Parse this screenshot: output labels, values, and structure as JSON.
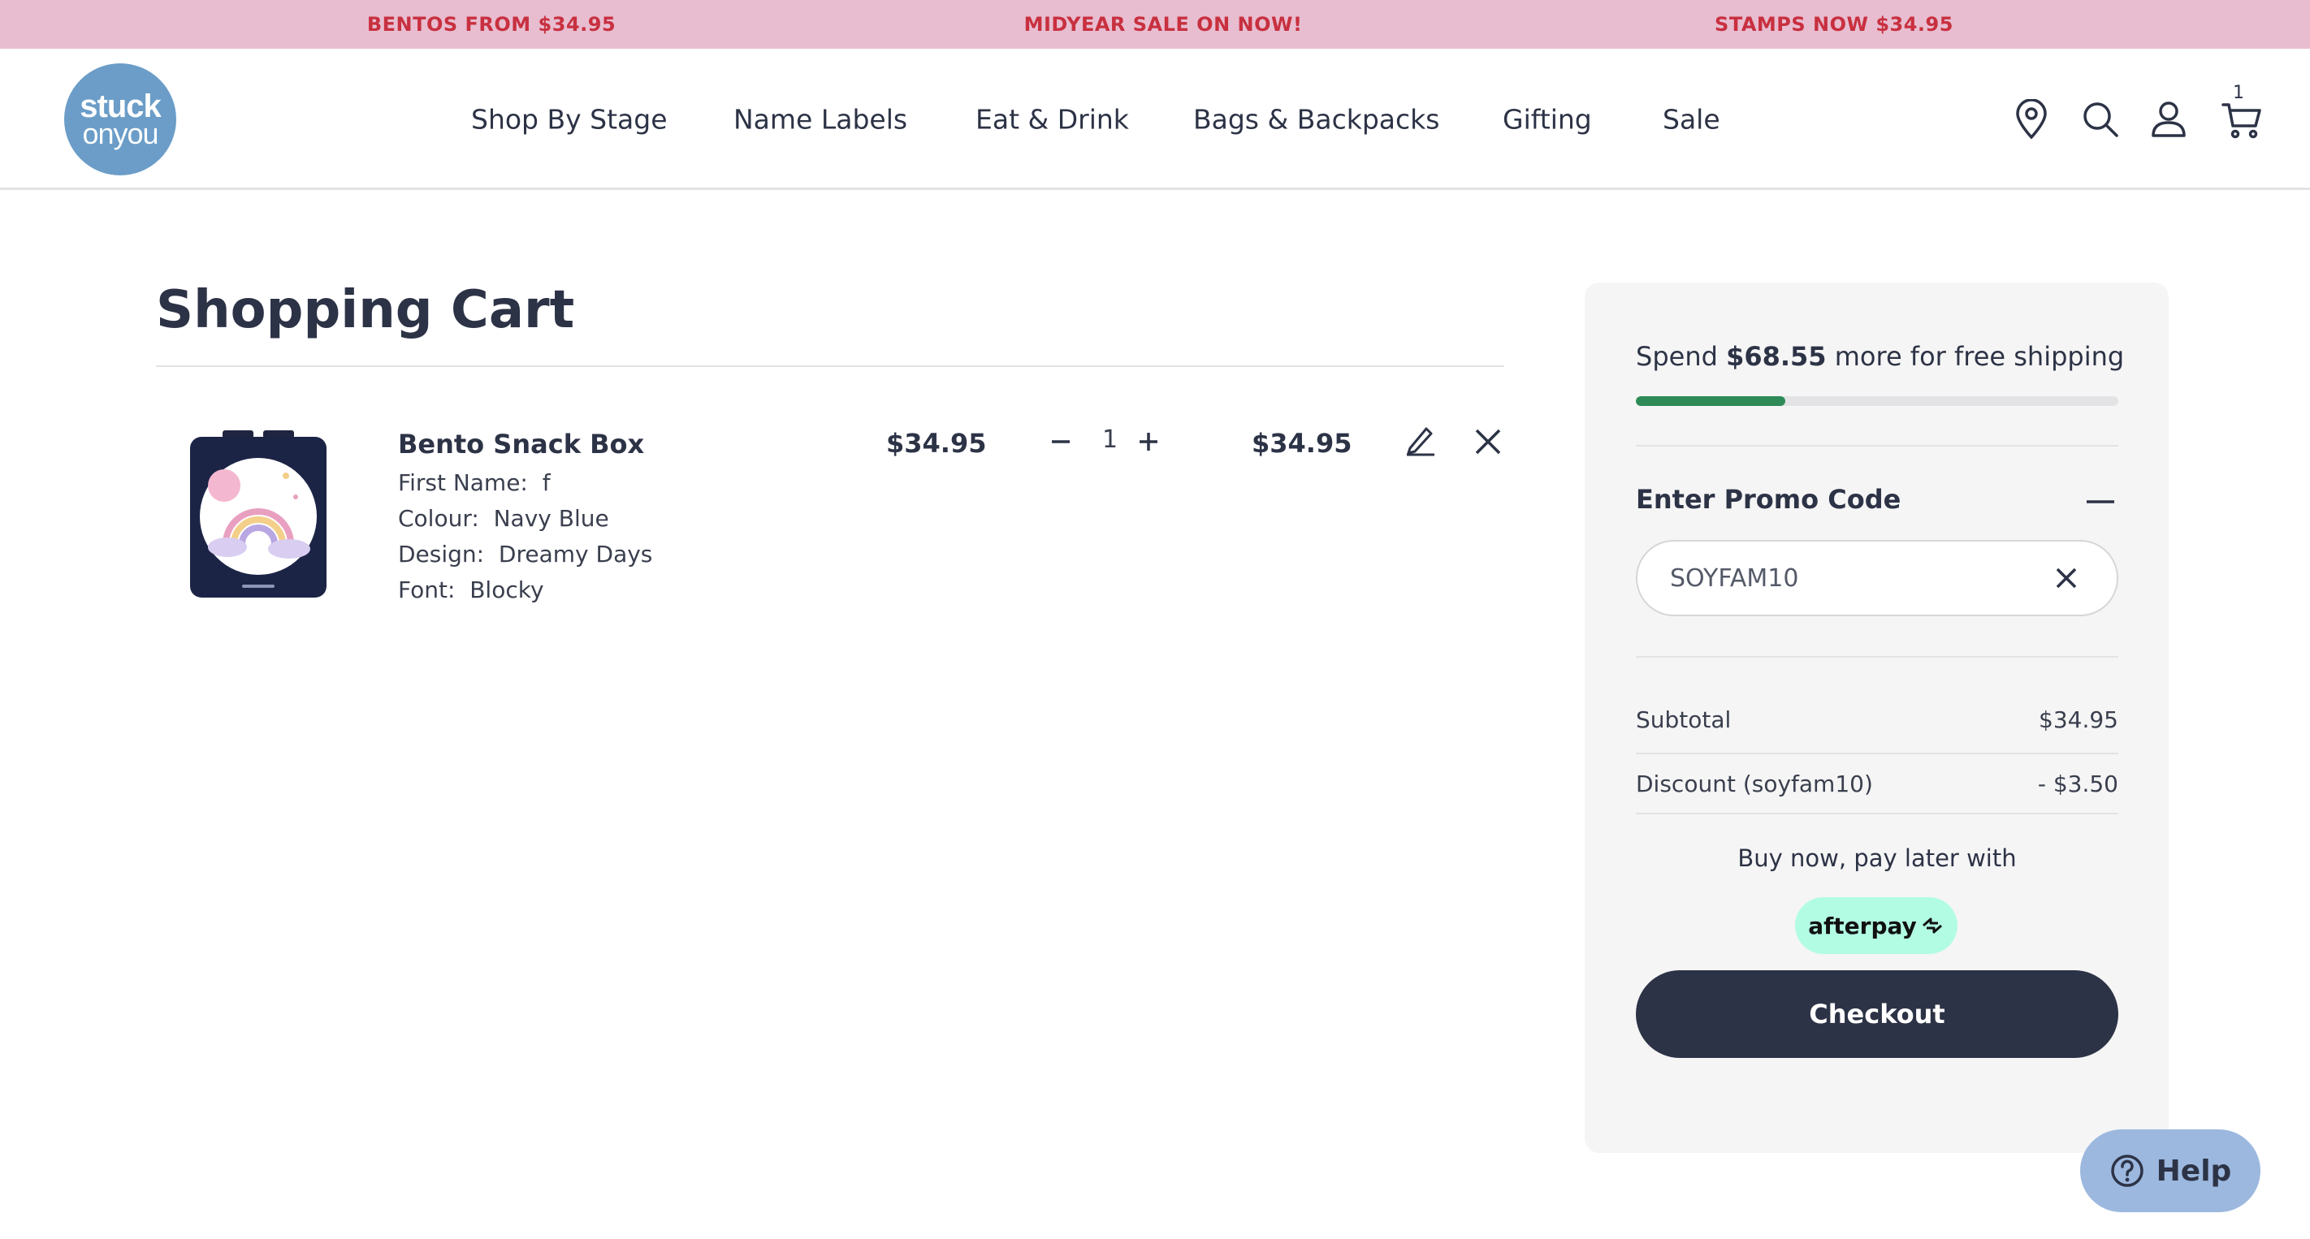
{
  "announcement": {
    "left": "BENTOS FROM $34.95",
    "center": "MIDYEAR SALE ON NOW!",
    "right": "STAMPS NOW $34.95"
  },
  "logo": {
    "line1": "stuck",
    "line2": "onyou"
  },
  "nav": {
    "items": [
      "Shop By Stage",
      "Name Labels",
      "Eat & Drink",
      "Bags & Backpacks",
      "Gifting",
      "Sale"
    ]
  },
  "header_icons": {
    "store": "location-pin-icon",
    "search": "search-icon",
    "account": "user-icon",
    "cart": "cart-icon",
    "cart_count": "1"
  },
  "cart": {
    "title": "Shopping Cart",
    "item": {
      "name": "Bento Snack Box",
      "options": [
        {
          "label": "First Name:",
          "value": "f"
        },
        {
          "label": "Colour:",
          "value": "Navy Blue"
        },
        {
          "label": "Design:",
          "value": "Dreamy Days"
        },
        {
          "label": "Font:",
          "value": "Blocky"
        }
      ],
      "unit_price": "$34.95",
      "quantity": "1",
      "line_total": "$34.95",
      "edit_icon": "pencil-icon",
      "remove_icon": "close-icon"
    }
  },
  "summary": {
    "shipping_prefix": "Spend",
    "shipping_amount": "$68.55",
    "shipping_suffix": "more for free shipping",
    "shipping_progress_pct": 31,
    "promo_title": "Enter Promo Code",
    "promo_value": "SOYFAM10",
    "subtotal_label": "Subtotal",
    "subtotal_value": "$34.95",
    "discount_label": "Discount (soyfam10)",
    "discount_value": "- $3.50",
    "bnpl_text": "Buy now, pay later with",
    "afterpay_label": "afterpay",
    "checkout_label": "Checkout"
  },
  "help": {
    "label": "Help"
  },
  "colors": {
    "announcement_bg": "#e8bdd0",
    "announcement_text": "#c8303f",
    "navy": "#2d3346",
    "logo_blue": "#6b9dc8",
    "progress_green": "#2e8b57",
    "afterpay_mint": "#b2fce4",
    "help_blue": "#9cb8df"
  }
}
